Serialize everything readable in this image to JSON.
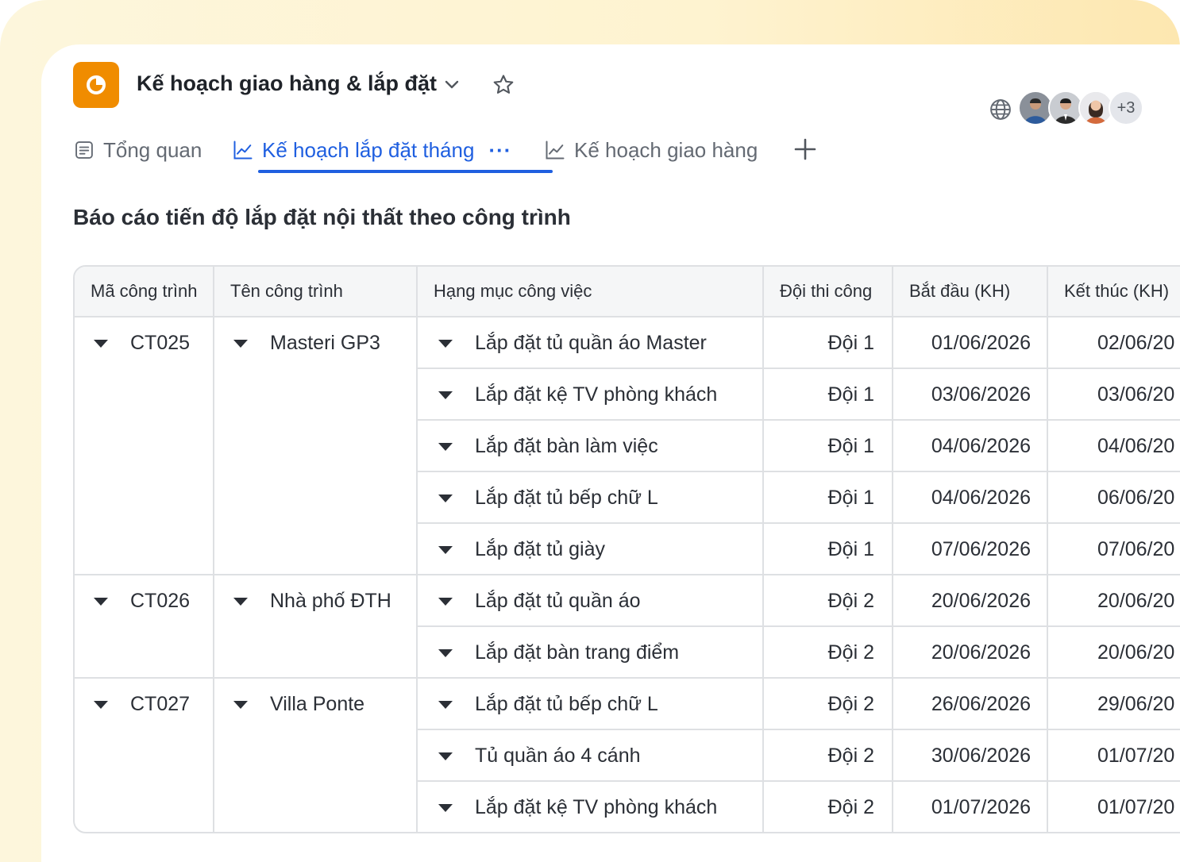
{
  "app": {
    "title": "Kế hoạch giao hàng & lắp đặt",
    "accent_color": "#f08c00",
    "icon": "pie-chart-icon"
  },
  "collaborators": {
    "avatars": [
      "avatar-man-blue-shirt",
      "avatar-man-suit",
      "avatar-woman"
    ],
    "more_label": "+3"
  },
  "tabs": [
    {
      "label": "Tổng quan",
      "icon": "document-icon",
      "active": false
    },
    {
      "label": "Kế hoạch lắp đặt tháng",
      "icon": "line-chart-icon",
      "active": true,
      "more": "···"
    },
    {
      "label": "Kế hoạch giao hàng",
      "icon": "line-chart-icon",
      "active": false
    }
  ],
  "active_color": "#1f5fe0",
  "report": {
    "title": "Báo cáo tiến độ lắp đặt nội thất theo công trình"
  },
  "table": {
    "columns": [
      "Mã công trình",
      "Tên công trình",
      "Hạng mục công việc",
      "Đội thi công",
      "Bắt đầu (KH)",
      "Kết thúc (KH)"
    ],
    "groups": [
      {
        "code": "CT025",
        "name": "Masteri GP3",
        "rows": [
          {
            "task": "Lắp đặt tủ quần áo Master",
            "team": "Đội 1",
            "start": "01/06/2026",
            "end": "02/06/20"
          },
          {
            "task": "Lắp đặt kệ TV phòng khách",
            "team": "Đội 1",
            "start": "03/06/2026",
            "end": "03/06/20"
          },
          {
            "task": "Lắp đặt bàn làm việc",
            "team": "Đội 1",
            "start": "04/06/2026",
            "end": "04/06/20"
          },
          {
            "task": "Lắp đặt tủ bếp chữ L",
            "team": "Đội 1",
            "start": "04/06/2026",
            "end": "06/06/20"
          },
          {
            "task": "Lắp đặt tủ giày",
            "team": "Đội 1",
            "start": "07/06/2026",
            "end": "07/06/20"
          }
        ]
      },
      {
        "code": "CT026",
        "name": "Nhà phố ĐTH",
        "rows": [
          {
            "task": "Lắp đặt tủ quần áo",
            "team": "Đội 2",
            "start": "20/06/2026",
            "end": "20/06/20"
          },
          {
            "task": "Lắp đặt bàn trang điểm",
            "team": "Đội 2",
            "start": "20/06/2026",
            "end": "20/06/20"
          }
        ]
      },
      {
        "code": "CT027",
        "name": "Villa Ponte",
        "rows": [
          {
            "task": "Lắp đặt tủ bếp chữ L",
            "team": "Đội 2",
            "start": "26/06/2026",
            "end": "29/06/20"
          },
          {
            "task": "Tủ quần áo 4 cánh",
            "team": "Đội 2",
            "start": "30/06/2026",
            "end": "01/07/20"
          },
          {
            "task": "Lắp đặt kệ TV phòng khách",
            "team": "Đội 2",
            "start": "01/07/2026",
            "end": "01/07/20"
          }
        ]
      }
    ]
  }
}
